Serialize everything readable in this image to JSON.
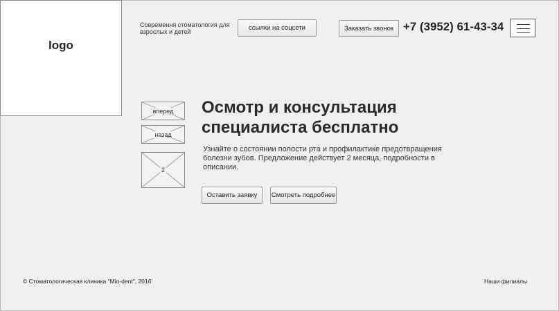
{
  "logo": {
    "text": "logo"
  },
  "header": {
    "tagline": "Современня стоматология для взрослых и детей",
    "social_button": "ссылки на соцсети",
    "call_button": "Заказать звонок",
    "phone": "+7 (3952) 61-43-34",
    "menu_icon": "hamburger-menu-icon"
  },
  "slider": {
    "next_label": "вперед",
    "back_label": "назад",
    "slide_number": "2"
  },
  "promo": {
    "headline": "Осмотр и консультация специалиста бесплатно",
    "description": "Узнайте о состоянии полости рта и профилактике предотвращения болезни зубов. Предложение действует 2 месяца, подробности в описании.",
    "request_button": "Оставить заявку",
    "more_button": "Смотреть подробнее"
  },
  "footer": {
    "copyright": "© Стоматологическая клиника \"Mio-dent\", 2016",
    "branches_link": "Наши филиалы"
  }
}
